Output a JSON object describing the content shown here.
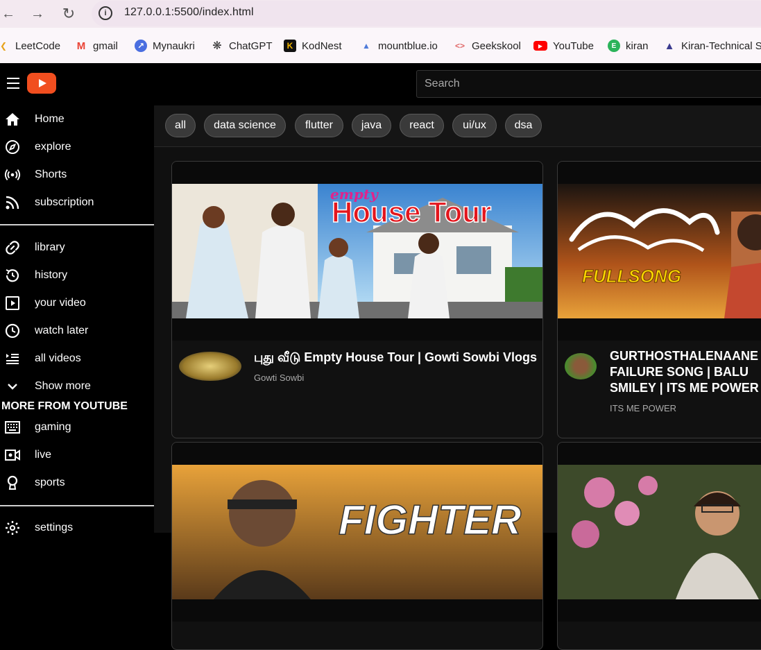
{
  "browser": {
    "url": "127.0.0.1:5500/index.html",
    "bookmarks": [
      {
        "label": "LeetCode",
        "icon": "leetcode-icon",
        "color": "#e7a21a"
      },
      {
        "label": "gmail",
        "icon": "gmail-icon",
        "color": "#ea4335"
      },
      {
        "label": "Mynaukri",
        "icon": "naukri-icon",
        "color": "#4a6ee0"
      },
      {
        "label": "ChatGPT",
        "icon": "chatgpt-icon",
        "color": "#333333"
      },
      {
        "label": "KodNest",
        "icon": "kodnest-icon",
        "color": "#f0b400"
      },
      {
        "label": "mountblue.io",
        "icon": "mountblue-icon",
        "color": "#4f7bd9"
      },
      {
        "label": "Geekskool",
        "icon": "geekskool-icon",
        "color": "#e06a6a"
      },
      {
        "label": "YouTube",
        "icon": "youtube-icon",
        "color": "#ff0000"
      },
      {
        "label": "kiran",
        "icon": "kiran-icon",
        "color": "#2bb35a"
      },
      {
        "label": "Kiran-Technical Su",
        "icon": "graduation-cap-icon",
        "color": "#3b3b8f"
      }
    ]
  },
  "header": {
    "search_placeholder": "Search",
    "accent": "#f14e1f"
  },
  "sidebar": {
    "items_main": [
      {
        "label": "Home",
        "icon": "home-icon"
      },
      {
        "label": "explore",
        "icon": "compass-icon"
      },
      {
        "label": "Shorts",
        "icon": "broadcast-icon"
      },
      {
        "label": "subscription",
        "icon": "rss-icon"
      }
    ],
    "items_library": [
      {
        "label": "library",
        "icon": "link-icon"
      },
      {
        "label": "history",
        "icon": "history-icon"
      },
      {
        "label": "your video",
        "icon": "play-square-icon"
      },
      {
        "label": "watch later",
        "icon": "clock-icon"
      },
      {
        "label": "all videos",
        "icon": "list-icon"
      },
      {
        "label": "Show more",
        "icon": "chevron-down-icon"
      }
    ],
    "more_heading": "MORE FROM YOUTUBE",
    "items_more": [
      {
        "label": "gaming",
        "icon": "keyboard-icon"
      },
      {
        "label": "live",
        "icon": "live-camera-icon"
      },
      {
        "label": "sports",
        "icon": "trophy-icon"
      }
    ],
    "items_bottom": [
      {
        "label": "settings",
        "icon": "gear-icon"
      }
    ]
  },
  "chips": [
    "all",
    "data science",
    "flutter",
    "java",
    "react",
    "ui/ux",
    "dsa"
  ],
  "videos": [
    {
      "title": "புது வீடு Empty House Tour | Gowti Sowbi Vlogs",
      "channel": "Gowti Sowbi",
      "thumb_caption": "empty",
      "thumb_headline": "House Tour"
    },
    {
      "title": "GURTHOSTHALENAANE FAILURE SONG | BALU SMILEY | ITS ME POWER",
      "channel": "ITS ME POWER",
      "thumb_caption": "FULLSONG"
    },
    {
      "title": "",
      "channel": "",
      "thumb_headline": "FIGHTER"
    },
    {
      "title": "",
      "channel": ""
    }
  ]
}
